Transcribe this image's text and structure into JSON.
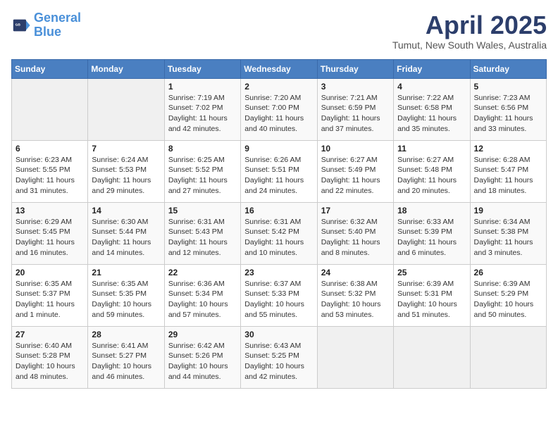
{
  "header": {
    "logo_line1": "General",
    "logo_line2": "Blue",
    "month_title": "April 2025",
    "location": "Tumut, New South Wales, Australia"
  },
  "weekdays": [
    "Sunday",
    "Monday",
    "Tuesday",
    "Wednesday",
    "Thursday",
    "Friday",
    "Saturday"
  ],
  "weeks": [
    [
      {
        "day": "",
        "info": ""
      },
      {
        "day": "",
        "info": ""
      },
      {
        "day": "1",
        "info": "Sunrise: 7:19 AM\nSunset: 7:02 PM\nDaylight: 11 hours and 42 minutes."
      },
      {
        "day": "2",
        "info": "Sunrise: 7:20 AM\nSunset: 7:00 PM\nDaylight: 11 hours and 40 minutes."
      },
      {
        "day": "3",
        "info": "Sunrise: 7:21 AM\nSunset: 6:59 PM\nDaylight: 11 hours and 37 minutes."
      },
      {
        "day": "4",
        "info": "Sunrise: 7:22 AM\nSunset: 6:58 PM\nDaylight: 11 hours and 35 minutes."
      },
      {
        "day": "5",
        "info": "Sunrise: 7:23 AM\nSunset: 6:56 PM\nDaylight: 11 hours and 33 minutes."
      }
    ],
    [
      {
        "day": "6",
        "info": "Sunrise: 6:23 AM\nSunset: 5:55 PM\nDaylight: 11 hours and 31 minutes."
      },
      {
        "day": "7",
        "info": "Sunrise: 6:24 AM\nSunset: 5:53 PM\nDaylight: 11 hours and 29 minutes."
      },
      {
        "day": "8",
        "info": "Sunrise: 6:25 AM\nSunset: 5:52 PM\nDaylight: 11 hours and 27 minutes."
      },
      {
        "day": "9",
        "info": "Sunrise: 6:26 AM\nSunset: 5:51 PM\nDaylight: 11 hours and 24 minutes."
      },
      {
        "day": "10",
        "info": "Sunrise: 6:27 AM\nSunset: 5:49 PM\nDaylight: 11 hours and 22 minutes."
      },
      {
        "day": "11",
        "info": "Sunrise: 6:27 AM\nSunset: 5:48 PM\nDaylight: 11 hours and 20 minutes."
      },
      {
        "day": "12",
        "info": "Sunrise: 6:28 AM\nSunset: 5:47 PM\nDaylight: 11 hours and 18 minutes."
      }
    ],
    [
      {
        "day": "13",
        "info": "Sunrise: 6:29 AM\nSunset: 5:45 PM\nDaylight: 11 hours and 16 minutes."
      },
      {
        "day": "14",
        "info": "Sunrise: 6:30 AM\nSunset: 5:44 PM\nDaylight: 11 hours and 14 minutes."
      },
      {
        "day": "15",
        "info": "Sunrise: 6:31 AM\nSunset: 5:43 PM\nDaylight: 11 hours and 12 minutes."
      },
      {
        "day": "16",
        "info": "Sunrise: 6:31 AM\nSunset: 5:42 PM\nDaylight: 11 hours and 10 minutes."
      },
      {
        "day": "17",
        "info": "Sunrise: 6:32 AM\nSunset: 5:40 PM\nDaylight: 11 hours and 8 minutes."
      },
      {
        "day": "18",
        "info": "Sunrise: 6:33 AM\nSunset: 5:39 PM\nDaylight: 11 hours and 6 minutes."
      },
      {
        "day": "19",
        "info": "Sunrise: 6:34 AM\nSunset: 5:38 PM\nDaylight: 11 hours and 3 minutes."
      }
    ],
    [
      {
        "day": "20",
        "info": "Sunrise: 6:35 AM\nSunset: 5:37 PM\nDaylight: 11 hours and 1 minute."
      },
      {
        "day": "21",
        "info": "Sunrise: 6:35 AM\nSunset: 5:35 PM\nDaylight: 10 hours and 59 minutes."
      },
      {
        "day": "22",
        "info": "Sunrise: 6:36 AM\nSunset: 5:34 PM\nDaylight: 10 hours and 57 minutes."
      },
      {
        "day": "23",
        "info": "Sunrise: 6:37 AM\nSunset: 5:33 PM\nDaylight: 10 hours and 55 minutes."
      },
      {
        "day": "24",
        "info": "Sunrise: 6:38 AM\nSunset: 5:32 PM\nDaylight: 10 hours and 53 minutes."
      },
      {
        "day": "25",
        "info": "Sunrise: 6:39 AM\nSunset: 5:31 PM\nDaylight: 10 hours and 51 minutes."
      },
      {
        "day": "26",
        "info": "Sunrise: 6:39 AM\nSunset: 5:29 PM\nDaylight: 10 hours and 50 minutes."
      }
    ],
    [
      {
        "day": "27",
        "info": "Sunrise: 6:40 AM\nSunset: 5:28 PM\nDaylight: 10 hours and 48 minutes."
      },
      {
        "day": "28",
        "info": "Sunrise: 6:41 AM\nSunset: 5:27 PM\nDaylight: 10 hours and 46 minutes."
      },
      {
        "day": "29",
        "info": "Sunrise: 6:42 AM\nSunset: 5:26 PM\nDaylight: 10 hours and 44 minutes."
      },
      {
        "day": "30",
        "info": "Sunrise: 6:43 AM\nSunset: 5:25 PM\nDaylight: 10 hours and 42 minutes."
      },
      {
        "day": "",
        "info": ""
      },
      {
        "day": "",
        "info": ""
      },
      {
        "day": "",
        "info": ""
      }
    ]
  ]
}
